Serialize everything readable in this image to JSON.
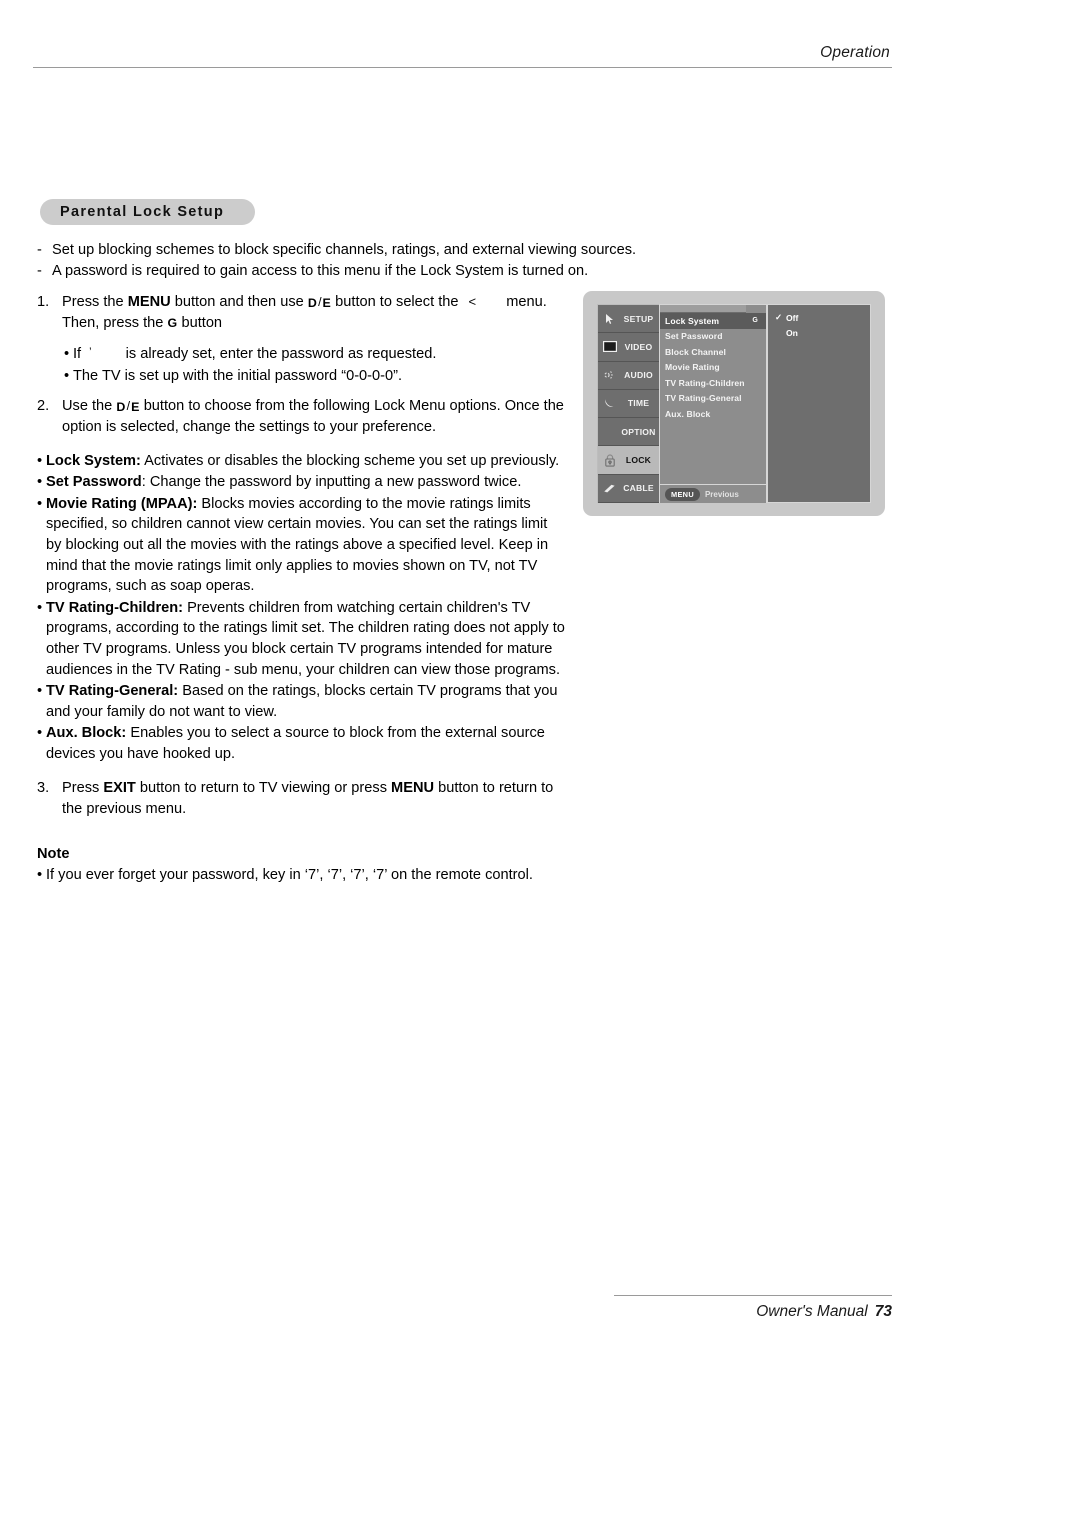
{
  "header": {
    "label": "Operation"
  },
  "section": {
    "title": "Parental Lock Setup"
  },
  "intro": {
    "dash": "-",
    "lines": [
      "Set up blocking schemes to block specific channels, ratings, and external viewing sources.",
      "A password is required to gain access to this menu if the Lock System is turned on."
    ]
  },
  "bullet": "•",
  "keys": {
    "up": "D",
    "down": "E",
    "sep": "/",
    "enter": "G",
    "lock_glyph": "<",
    "password_glyph": "’"
  },
  "steps": [
    {
      "num": "1.",
      "part1": "Press the ",
      "menu": "MENU",
      "part2": " button and then use ",
      "part3": " button to select the ",
      "part4": " menu. Then, press the ",
      "part5": " button"
    },
    {
      "num": "2.",
      "part1": "Use the ",
      "part2": " button to choose from the following Lock Menu options. Once the option is selected, change the settings to your preference."
    },
    {
      "num": "3.",
      "part1": "Press ",
      "exit": "EXIT",
      "part2": " button to return to TV viewing or press ",
      "menu": "MENU",
      "part3": " button to return to the previous menu."
    }
  ],
  "sub_bullets": [
    {
      "pre": "If ",
      "post": " is already set, enter the password as requested."
    },
    {
      "pre": "The TV is set up with the initial password “0-0-0-0”.",
      "post": ""
    }
  ],
  "options": [
    {
      "term": "Lock System:",
      "desc": " Activates or disables the blocking scheme you set up previously."
    },
    {
      "term": "Set Password",
      "desc": ": Change the password by inputting a new password twice."
    },
    {
      "term": "Movie Rating (MPAA):",
      "desc": " Blocks movies according to the movie ratings limits specified, so children cannot view certain movies. You can set the ratings limit by blocking out all the movies with the ratings above a specified level. Keep in mind that the movie ratings limit only applies to movies shown on TV, not TV programs, such as soap operas."
    },
    {
      "term": "TV Rating-Children:",
      "desc": " Prevents children from watching certain children's TV programs, according to the ratings limit set. The children rating does not apply to other TV programs. Unless you block certain TV programs intended for mature audiences in the TV Rating - sub menu, your children can view those programs."
    },
    {
      "term": "TV Rating-General:",
      "desc": " Based on the ratings, blocks certain TV programs that you and your family do not want to view."
    },
    {
      "term": "Aux. Block:",
      "desc": " Enables you to select a source to block from the external source devices you have hooked up."
    }
  ],
  "note": {
    "heading": "Note",
    "text": "If you ever forget your password, key in ‘7’, ‘7’, ‘7’, ‘7’ on the remote control."
  },
  "osd": {
    "rail": [
      {
        "label": "SETUP",
        "icon": "cursor-arrow-icon",
        "active": false
      },
      {
        "label": "VIDEO",
        "icon": "screen-icon",
        "active": false
      },
      {
        "label": "AUDIO",
        "icon": "sound-icon",
        "active": false
      },
      {
        "label": "TIME",
        "icon": "moon-icon",
        "active": false
      },
      {
        "label": "OPTION",
        "icon": "none",
        "active": false
      },
      {
        "label": "LOCK",
        "icon": "padlock-icon",
        "active": true
      },
      {
        "label": "CABLE",
        "icon": "cable-icon",
        "active": false
      }
    ],
    "menu_items": [
      {
        "label": "Lock System",
        "key": "G",
        "selected": true
      },
      {
        "label": "Set Password",
        "key": "",
        "selected": false
      },
      {
        "label": "Block Channel",
        "key": "",
        "selected": false
      },
      {
        "label": "Movie Rating",
        "key": "",
        "selected": false
      },
      {
        "label": "TV Rating-Children",
        "key": "",
        "selected": false
      },
      {
        "label": "TV Rating-General",
        "key": "",
        "selected": false
      },
      {
        "label": "Aux. Block",
        "key": "",
        "selected": false
      }
    ],
    "footer": {
      "menu_key": "MENU",
      "previous": "Previous"
    },
    "values": [
      {
        "label": "Off",
        "checked": true,
        "check": "✓"
      },
      {
        "label": "On",
        "checked": false,
        "check": ""
      }
    ]
  },
  "footer": {
    "manual": "Owner's Manual",
    "page": "73"
  },
  "colors": {
    "pill_bg": "#cccccc",
    "osd_frame": "#c8c8c8",
    "osd_rail": "#6e6e6e",
    "osd_mid": "#8d8d8d",
    "osd_selected": "#5b5b5b",
    "osd_active": "#b9b9b9",
    "rule": "#9a9a9a"
  }
}
